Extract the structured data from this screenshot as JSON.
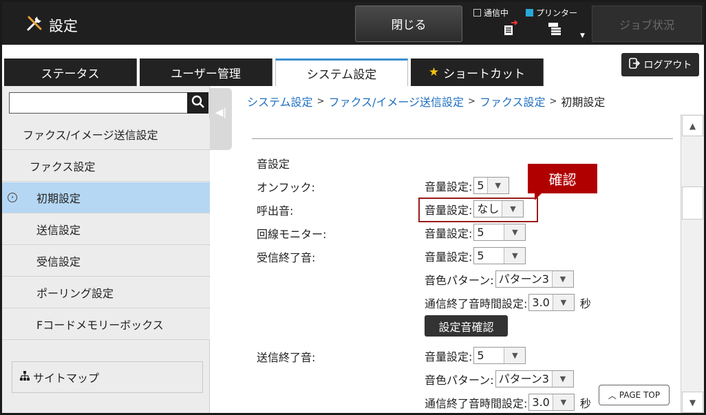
{
  "header": {
    "title": "設定",
    "close_label": "閉じる",
    "comm_label": "通信中",
    "printer_label": "プリンター",
    "job_status_label": "ジョブ状況",
    "logout_label": "ログアウト"
  },
  "tabs": [
    {
      "label": "ステータス"
    },
    {
      "label": "ユーザー管理"
    },
    {
      "label": "システム設定"
    },
    {
      "label": "ショートカット"
    }
  ],
  "sidebar": {
    "search_placeholder": "",
    "items": [
      {
        "label": "ファクス/イメージ送信設定"
      },
      {
        "label": "ファクス設定"
      },
      {
        "label": "初期設定"
      },
      {
        "label": "送信設定"
      },
      {
        "label": "受信設定"
      },
      {
        "label": "ポーリング設定"
      },
      {
        "label": "Fコードメモリーボックス"
      }
    ],
    "sitemap_label": "サイトマップ"
  },
  "breadcrumb": {
    "items": [
      "システム設定",
      "ファクス/イメージ送信設定",
      "ファクス設定"
    ],
    "current": "初期設定",
    "sep": ">"
  },
  "main": {
    "section_title": "音設定",
    "rows": {
      "onhook": "オンフック:",
      "ring": "呼出音:",
      "line_monitor": "回線モニター:",
      "rx_end": "受信終了音:",
      "tx_end": "送信終了音:"
    },
    "volume_label": "音量設定:",
    "pattern_label": "音色パターン:",
    "duration_label": "通信終了音時間設定:",
    "seconds_unit": "秒",
    "values": {
      "onhook_vol": "5",
      "ring_vol": "なし",
      "line_vol": "5",
      "rx_vol": "5",
      "rx_pattern": "パターン3",
      "rx_duration": "3.0",
      "tx_vol": "5",
      "tx_pattern": "パターン3",
      "tx_duration": "3.0"
    },
    "test_button": "設定音確認",
    "callout": "確認"
  },
  "page_top_label": "PAGE TOP",
  "colors": {
    "header_bg": "#1f1f1f",
    "accent": "#3a8fd0",
    "selected_item": "#b5d7f4",
    "highlight": "#b00000",
    "link": "#1e6fc0"
  }
}
